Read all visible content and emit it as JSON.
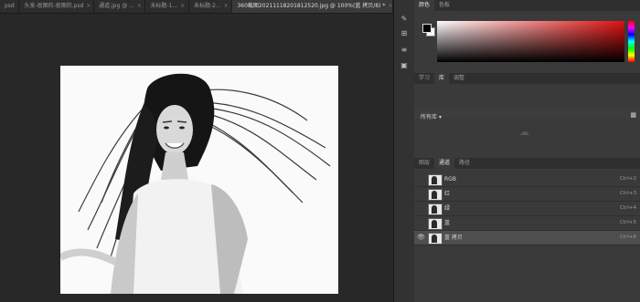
{
  "tabs": [
    {
      "label": "psd",
      "active": false
    },
    {
      "label": "头发-抠图的-抠图的.psd",
      "active": false
    },
    {
      "label": "通道.jpg @ ...",
      "active": false
    },
    {
      "label": "未标题-1...",
      "active": false
    },
    {
      "label": "未标题-2...",
      "active": false
    },
    {
      "label": "360截图20211118201812520.jpg @ 100%(蓝 拷贝/8) *",
      "active": true
    }
  ],
  "tab_close": "×",
  "color_panel": {
    "tabs": [
      "颜色",
      "色板"
    ]
  },
  "library_panel": {
    "tabs": [
      "学习",
      "库",
      "调整"
    ],
    "dropdown": "所有库"
  },
  "channels_panel": {
    "tabs": [
      "图层",
      "通道",
      "路径"
    ],
    "channels": [
      {
        "name": "RGB",
        "shortcut": "Ctrl+2",
        "visible": false,
        "selected": false
      },
      {
        "name": "红",
        "shortcut": "Ctrl+3",
        "visible": false,
        "selected": false
      },
      {
        "name": "绿",
        "shortcut": "Ctrl+4",
        "visible": false,
        "selected": false
      },
      {
        "name": "蓝",
        "shortcut": "Ctrl+5",
        "visible": false,
        "selected": false
      },
      {
        "name": "蓝 拷贝",
        "shortcut": "Ctrl+6",
        "visible": true,
        "selected": true
      }
    ]
  },
  "icons": {
    "eye": "eye-icon",
    "cloud": "creative-cloud-icon"
  }
}
